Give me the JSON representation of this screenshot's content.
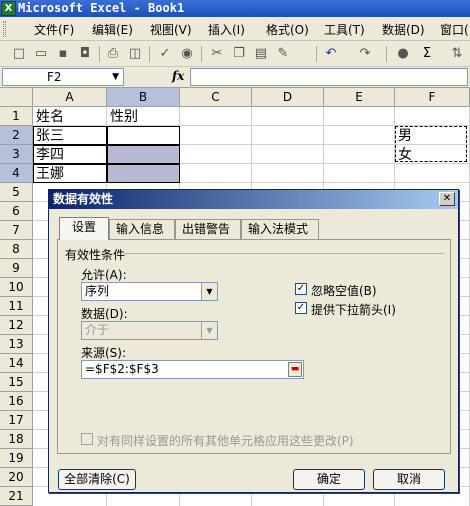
{
  "window": {
    "title": "Microsoft Excel - Book1",
    "app_icon_glyph": "X"
  },
  "menu": [
    "文件(F)",
    "编辑(E)",
    "视图(V)",
    "插入(I)",
    "格式(O)",
    "工具(T)",
    "数据(D)",
    "窗口("
  ],
  "toolbar": {
    "icons": [
      "new-icon",
      "open-icon",
      "save-icon",
      "permission-icon",
      "print-icon",
      "print-preview-icon",
      "spelling-icon",
      "research-icon",
      "cut-icon",
      "copy-icon",
      "paste-icon",
      "format-painter-icon",
      "undo-icon",
      "redo-icon",
      "hyperlink-icon",
      "autosum-icon",
      "sort-icon"
    ],
    "sigma": "Σ"
  },
  "formula_bar": {
    "name_box": "F2",
    "fx_label": "fx",
    "formula": ""
  },
  "grid": {
    "columns": [
      "A",
      "B",
      "C",
      "D",
      "E",
      "F"
    ],
    "rows": [
      "1",
      "2",
      "3",
      "4",
      "5",
      "6",
      "7",
      "8",
      "9",
      "10",
      "11",
      "12",
      "13",
      "14",
      "15",
      "16",
      "17",
      "18",
      "19",
      "20",
      "21"
    ],
    "selected_column": "B",
    "cells": {
      "A1": "姓名",
      "B1": "性别",
      "A2": "张三",
      "A3": "李四",
      "A4": "王娜",
      "F2": "男",
      "F3": "女"
    }
  },
  "dialog": {
    "title": "数据有效性",
    "tabs": [
      "设置",
      "输入信息",
      "出错警告",
      "输入法模式"
    ],
    "active_tab": "设置",
    "group_label": "有效性条件",
    "allow_label": "允许(A):",
    "allow_value": "序列",
    "data_label": "数据(D):",
    "data_value": "介于",
    "source_label": "来源(S):",
    "source_value": "=$F$2:$F$3",
    "ignore_blank_label": "忽略空值(B)",
    "ignore_blank_checked": true,
    "dropdown_label": "提供下拉箭头(I)",
    "dropdown_checked": true,
    "apply_all_label": "对有同样设置的所有其他单元格应用这些更改(P)",
    "apply_all_checked": false,
    "clear_all_button": "全部清除(C)",
    "ok_button": "确定",
    "cancel_button": "取消"
  },
  "colors": {
    "accent_title": "#1f4fb8",
    "selection_fill": "#b5bad3",
    "face": "#ece9d8"
  }
}
